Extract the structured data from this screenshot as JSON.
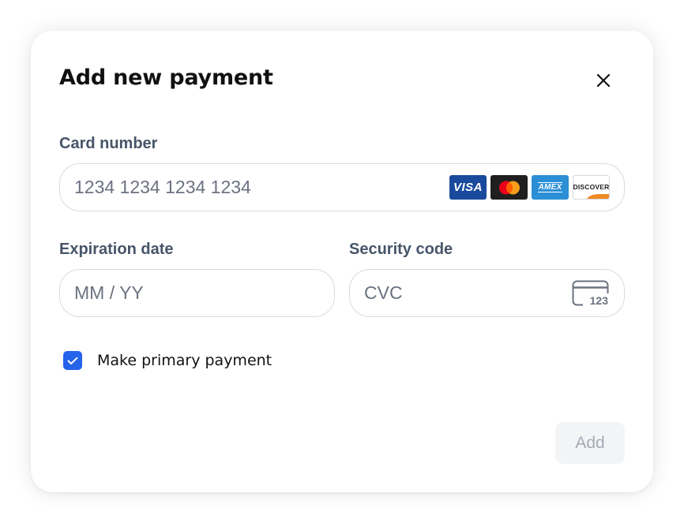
{
  "dialog": {
    "title": "Add new payment",
    "close_icon": "close-icon"
  },
  "card_number": {
    "label": "Card number",
    "placeholder": "1234 1234 1234 1234",
    "value": "",
    "brands": [
      {
        "name": "visa",
        "text": "VISA",
        "color": "#1a4a9c"
      },
      {
        "name": "mastercard",
        "text": "",
        "color": "#1f1f1f"
      },
      {
        "name": "amex",
        "text": "AMEX",
        "color": "#2b8fd6"
      },
      {
        "name": "discover",
        "text": "DISCOVER",
        "color": "#f08a24"
      }
    ]
  },
  "expiration": {
    "label": "Expiration date",
    "placeholder": "MM / YY",
    "value": ""
  },
  "security": {
    "label": "Security code",
    "placeholder": "CVC",
    "value": "",
    "icon": "card-cvc-icon",
    "icon_text": "123"
  },
  "primary": {
    "label": "Make primary payment",
    "checked": true,
    "color": "#2563eb"
  },
  "actions": {
    "add_label": "Add",
    "add_enabled": false
  }
}
